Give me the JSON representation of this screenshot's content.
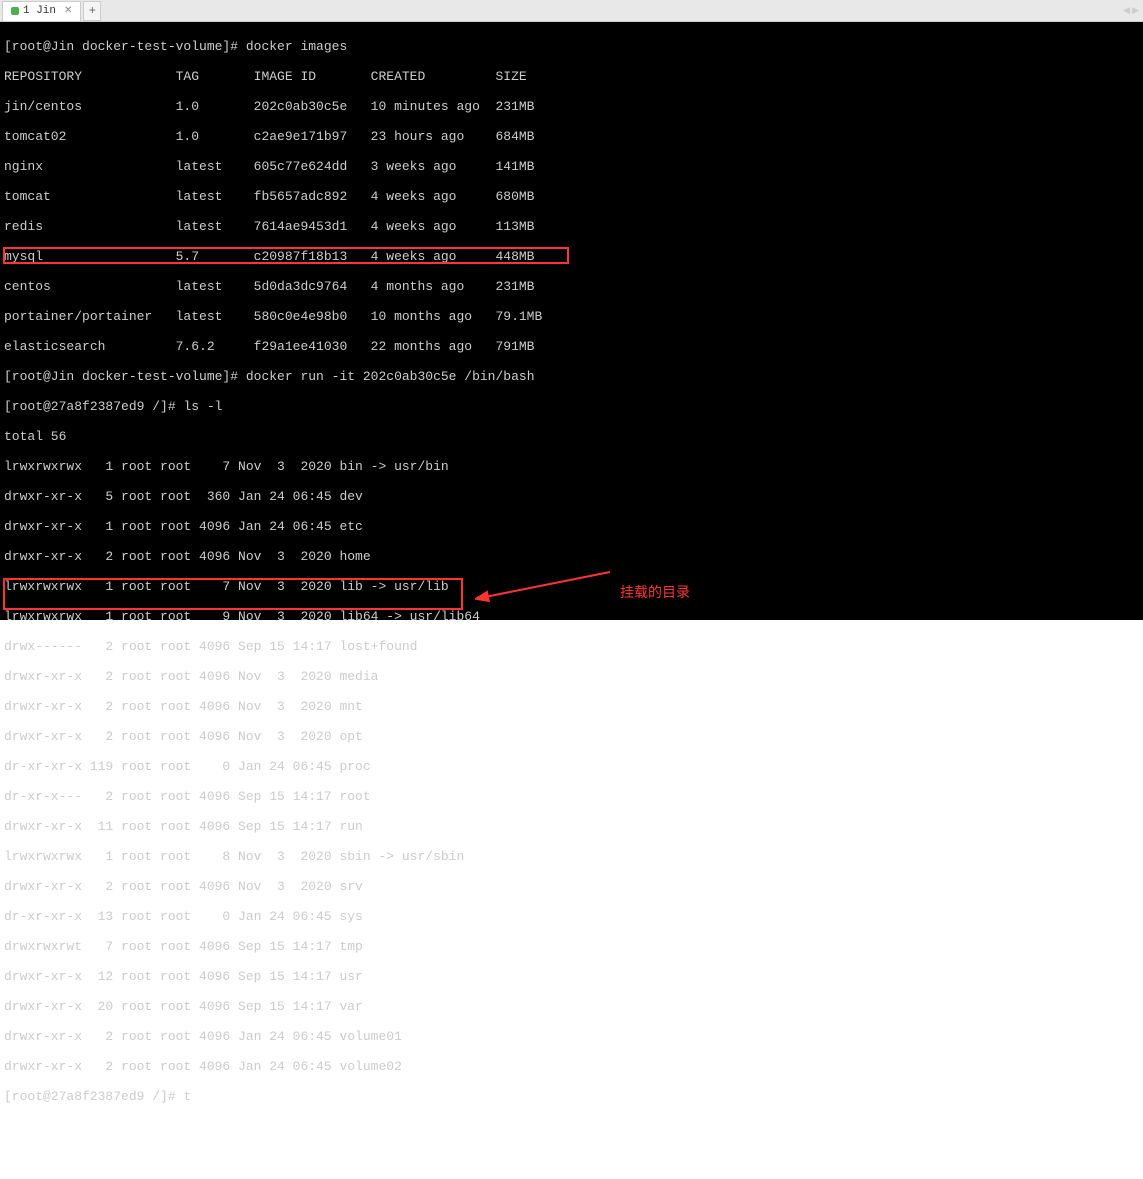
{
  "tab": {
    "label": "1 Jin"
  },
  "prompt1": "[root@Jin docker-test-volume]# ",
  "cmd1": "docker images",
  "header": "REPOSITORY            TAG       IMAGE ID       CREATED         SIZE",
  "images": [
    "jin/centos            1.0       202c0ab30c5e   10 minutes ago  231MB",
    "tomcat02              1.0       c2ae9e171b97   23 hours ago    684MB",
    "nginx                 latest    605c77e624dd   3 weeks ago     141MB",
    "tomcat                latest    fb5657adc892   4 weeks ago     680MB",
    "redis                 latest    7614ae9453d1   4 weeks ago     113MB",
    "mysql                 5.7       c20987f18b13   4 weeks ago     448MB",
    "centos                latest    5d0da3dc9764   4 months ago    231MB",
    "portainer/portainer   latest    580c0e4e98b0   10 months ago   79.1MB",
    "elasticsearch         7.6.2     f29a1ee41030   22 months ago   791MB"
  ],
  "cmd2": "docker run -it 202c0ab30c5e /bin/bash",
  "prompt2": "[root@27a8f2387ed9 /]# ",
  "cmd3": "ls -l",
  "total": "total 56",
  "ls": [
    "lrwxrwxrwx   1 root root    7 Nov  3  2020 bin -> usr/bin",
    "drwxr-xr-x   5 root root  360 Jan 24 06:45 dev",
    "drwxr-xr-x   1 root root 4096 Jan 24 06:45 etc",
    "drwxr-xr-x   2 root root 4096 Nov  3  2020 home",
    "lrwxrwxrwx   1 root root    7 Nov  3  2020 lib -> usr/lib",
    "lrwxrwxrwx   1 root root    9 Nov  3  2020 lib64 -> usr/lib64",
    "drwx------   2 root root 4096 Sep 15 14:17 lost+found",
    "drwxr-xr-x   2 root root 4096 Nov  3  2020 media",
    "drwxr-xr-x   2 root root 4096 Nov  3  2020 mnt",
    "drwxr-xr-x   2 root root 4096 Nov  3  2020 opt",
    "dr-xr-xr-x 119 root root    0 Jan 24 06:45 proc",
    "dr-xr-x---   2 root root 4096 Sep 15 14:17 root",
    "drwxr-xr-x  11 root root 4096 Sep 15 14:17 run",
    "lrwxrwxrwx   1 root root    8 Nov  3  2020 sbin -> usr/sbin",
    "drwxr-xr-x   2 root root 4096 Nov  3  2020 srv",
    "dr-xr-xr-x  13 root root    0 Jan 24 06:45 sys",
    "drwxrwxrwt   7 root root 4096 Sep 15 14:17 tmp",
    "drwxr-xr-x  12 root root 4096 Sep 15 14:17 usr",
    "drwxr-xr-x  20 root root 4096 Sep 15 14:17 var",
    "drwxr-xr-x   2 root root 4096 Jan 24 06:45 volume01",
    "drwxr-xr-x   2 root root 4096 Jan 24 06:45 volume02"
  ],
  "cmd4": "t",
  "annotation": "挂载的目录"
}
